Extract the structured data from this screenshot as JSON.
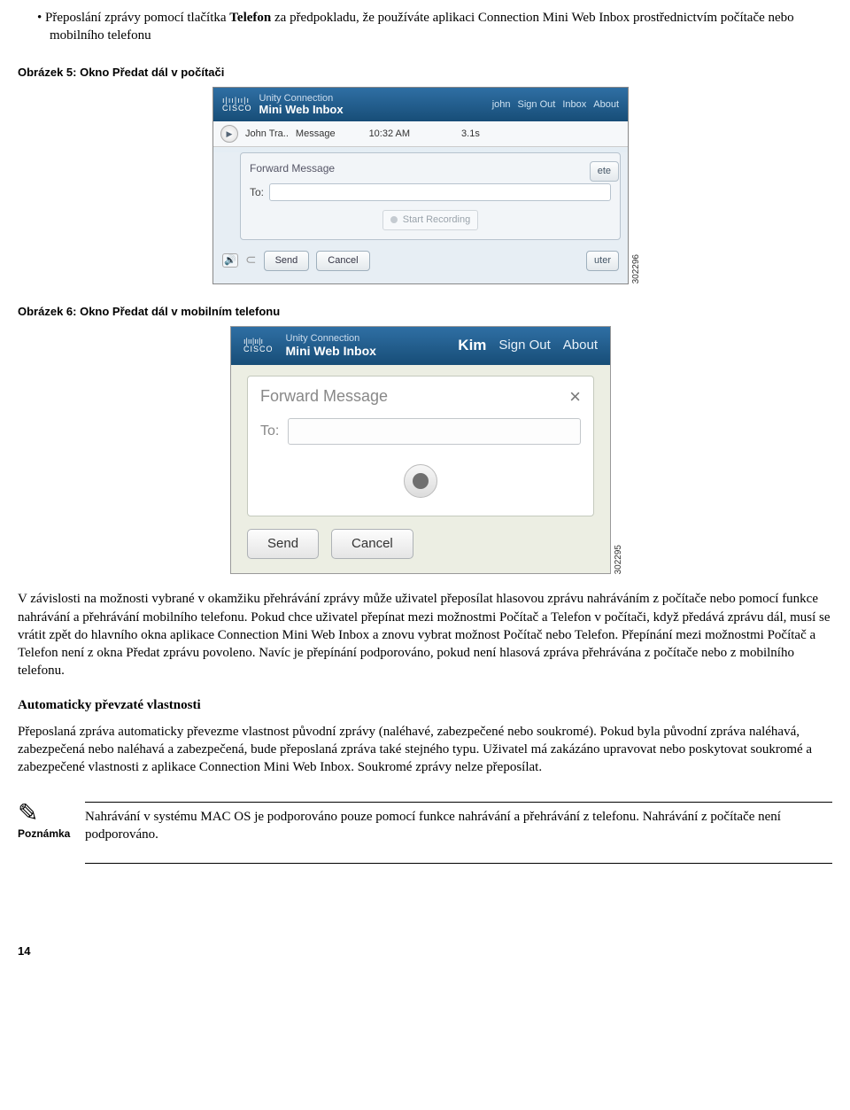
{
  "bullet": {
    "pre": "Přeposlání zprávy pomocí tlačítka ",
    "bold": "Telefon",
    "post": " za předpokladu, že používáte aplikaci Connection Mini Web Inbox prostřednictvím počítače nebo mobilního telefonu"
  },
  "fig5": {
    "caption": "Obrázek 5: Okno Předat dál v počítači",
    "image_id": "302296",
    "brand_l1": "Unity Connection",
    "brand_l2": "Mini Web Inbox",
    "user": "john",
    "nav_signout": "Sign Out",
    "nav_inbox": "Inbox",
    "nav_about": "About",
    "msg_from": "John Tra..",
    "msg_subj": "Message",
    "msg_time": "10:32 AM",
    "msg_dur": "3.1s",
    "ete": "ete",
    "fwd_title": "Forward Message",
    "to_label": "To:",
    "start_rec": "Start Recording",
    "send": "Send",
    "cancel": "Cancel",
    "right_frag": "uter"
  },
  "fig6": {
    "caption": "Obrázek 6: Okno Předat dál v mobilním telefonu",
    "image_id": "302295",
    "brand_l1": "Unity Connection",
    "brand_l2": "Mini Web Inbox",
    "user": "Kim",
    "nav_signout": "Sign Out",
    "nav_about": "About",
    "fwd_title": "Forward Message",
    "to_label": "To:",
    "send": "Send",
    "cancel": "Cancel"
  },
  "para1": "V závislosti na možnosti vybrané v okamžiku přehrávání zprávy může uživatel přeposílat hlasovou zprávu nahráváním z počítače nebo pomocí funkce nahrávání a přehrávání mobilního telefonu. Pokud chce uživatel přepínat mezi možnostmi Počítač a Telefon v počítači, když předává zprávu dál, musí se vrátit zpět do hlavního okna aplikace Connection Mini Web Inbox a znovu vybrat možnost Počítač nebo Telefon. Přepínání mezi možnostmi Počítač a Telefon není z okna Předat zprávu povoleno. Navíc je přepínání podporováno, pokud není hlasová zpráva přehrávána z počítače nebo z mobilního telefonu.",
  "subhead": "Automaticky převzaté vlastnosti",
  "para2": "Přeposlaná zpráva automaticky převezme vlastnost původní zprávy (naléhavé, zabezpečené nebo soukromé). Pokud byla původní zpráva naléhavá, zabezpečená nebo naléhavá a zabezpečená, bude přeposlaná zpráva také stejného typu. Uživatel má zakázáno upravovat nebo poskytovat soukromé a zabezpečené vlastnosti z aplikace Connection Mini Web Inbox. Soukromé zprávy nelze přeposílat.",
  "note": {
    "label": "Poznámka",
    "text": "Nahrávání v systému MAC OS je podporováno pouze pomocí funkce nahrávání a přehrávání z telefonu. Nahrávání z počítače není podporováno."
  },
  "page_number": "14"
}
